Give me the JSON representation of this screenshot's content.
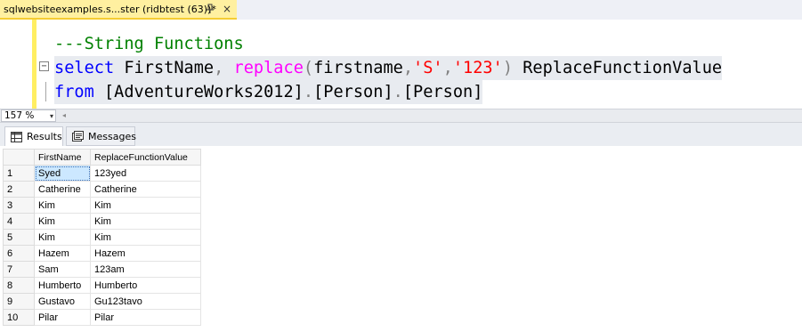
{
  "tab": {
    "title": "sqlwebsiteexamples.s...ster (ridbtest (63))*",
    "pin_icon": "pin-icon",
    "close_icon": "close-icon",
    "close_glyph": "×"
  },
  "editor": {
    "line1": {
      "comment": "---String Functions"
    },
    "line2": {
      "kw_select": "select",
      "col": " FirstName",
      "comma": ",",
      "fn": " replace",
      "paren_open": "(",
      "arg1": "firstname",
      "comma2": ",",
      "str1": "'S'",
      "comma3": ",",
      "str2": "'123'",
      "paren_close": ")",
      "alias": " ReplaceFunctionValue"
    },
    "line3": {
      "kw_from": "from",
      "db": " [AdventureWorks2012]",
      "dot1": ".",
      "schema": "[Person]",
      "dot2": ".",
      "table": "[Person]"
    },
    "fold_glyph": "−"
  },
  "zoom": {
    "value": "157 %",
    "arrow": "▾",
    "scroll_left": "◂"
  },
  "result_tabs": [
    {
      "label": "Results",
      "icon": "grid-icon"
    },
    {
      "label": "Messages",
      "icon": "messages-icon"
    }
  ],
  "grid": {
    "columns": [
      "FirstName",
      "ReplaceFunctionValue"
    ],
    "rows": [
      {
        "num": "1",
        "first": "Syed",
        "replaced": "123yed"
      },
      {
        "num": "2",
        "first": "Catherine",
        "replaced": "Catherine"
      },
      {
        "num": "3",
        "first": "Kim",
        "replaced": "Kim"
      },
      {
        "num": "4",
        "first": "Kim",
        "replaced": "Kim"
      },
      {
        "num": "5",
        "first": "Kim",
        "replaced": "Kim"
      },
      {
        "num": "6",
        "first": "Hazem",
        "replaced": "Hazem"
      },
      {
        "num": "7",
        "first": "Sam",
        "replaced": "123am"
      },
      {
        "num": "8",
        "first": "Humberto",
        "replaced": "Humberto"
      },
      {
        "num": "9",
        "first": "Gustavo",
        "replaced": "Gu123tavo"
      },
      {
        "num": "10",
        "first": "Pilar",
        "replaced": "Pilar"
      }
    ],
    "selected_color": "#cce8ff"
  },
  "colors": {
    "tab_active": "#fff0a0",
    "change_bar": "#ffee62",
    "keyword": "#0000ff",
    "function": "#ff00ff",
    "string": "#ff0000",
    "comment": "#008000"
  }
}
